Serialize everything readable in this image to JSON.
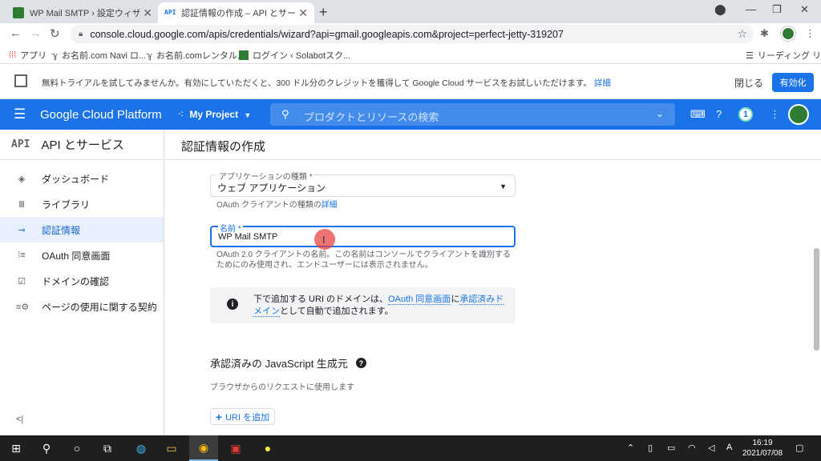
{
  "browser": {
    "tabs": [
      {
        "title": "WP Mail SMTP › 設定ウィザード",
        "active": false
      },
      {
        "title": "認証情報の作成 – API とサービス – ",
        "active": true
      }
    ],
    "new_tab": "+",
    "url": "console.cloud.google.com/apis/credentials/wizard?api=gmail.googleapis.com&project=perfect-jetty-319207",
    "bookmarks": [
      {
        "label": "アプリ"
      },
      {
        "label": "お名前.com Navi ロ..."
      },
      {
        "label": "お名前.comレンタル..."
      },
      {
        "label": "ログイン ‹ Solabotスク..."
      }
    ],
    "reading_list": "リーディング リスト"
  },
  "banner": {
    "message": "無料トライアルを試してみませんか。有効にしていただくと、300 ドル分のクレジットを獲得して Google Cloud サービスをお試しいただけます。",
    "details_link": "詳細",
    "close_label": "閉じる",
    "enable_label": "有効化"
  },
  "gcp": {
    "brand": "Google Cloud Platform",
    "project": "My Project",
    "search_placeholder": "プロダクトとリソースの検索",
    "notification_count": "1"
  },
  "sidebar": {
    "logo": "API",
    "title": "API とサービス",
    "items": [
      {
        "label": "ダッシュボード",
        "icon": "dashboard-icon"
      },
      {
        "label": "ライブラリ",
        "icon": "library-icon"
      },
      {
        "label": "認証情報",
        "icon": "key-icon",
        "active": true
      },
      {
        "label": "OAuth 同意画面",
        "icon": "consent-icon"
      },
      {
        "label": "ドメインの確認",
        "icon": "checkbox-icon"
      },
      {
        "label": "ページの使用に関する契約",
        "icon": "settings-list-icon"
      }
    ],
    "collapse": "<|"
  },
  "main": {
    "title": "認証情報の作成",
    "app_type": {
      "label": "アプリケーションの種類 *",
      "value": "ウェブ アプリケーション",
      "hint_prefix": "OAuth クライアントの種類の",
      "hint_link": "詳細"
    },
    "name": {
      "label": "名前 *",
      "value": "WP Mail SMTP",
      "hint_line1": "OAuth 2.0 クライアントの名前。この名前はコンソールでクライアントを識別する",
      "hint_line2": "ためにのみ使用され、エンドユーザーには表示されません。"
    },
    "info": {
      "text_1": "下で追加する URI のドメインは、",
      "link_1": "OAuth 同意画面",
      "text_2": "に",
      "link_2": "承認済みドメイン",
      "text_3": "として自動で追加されます。"
    },
    "js_origins": {
      "title": "承認済みの JavaScript 生成元",
      "subtitle": "ブラウザからのリクエストに使用します",
      "add_button": "URI を追加"
    }
  },
  "taskbar": {
    "time": "16:19",
    "date": "2021/07/08",
    "ime": "A"
  },
  "colors": {
    "gcp_blue": "#1a73e8",
    "active_nav_bg": "#e8f0fe",
    "taskbar": "#1f1f1f"
  }
}
